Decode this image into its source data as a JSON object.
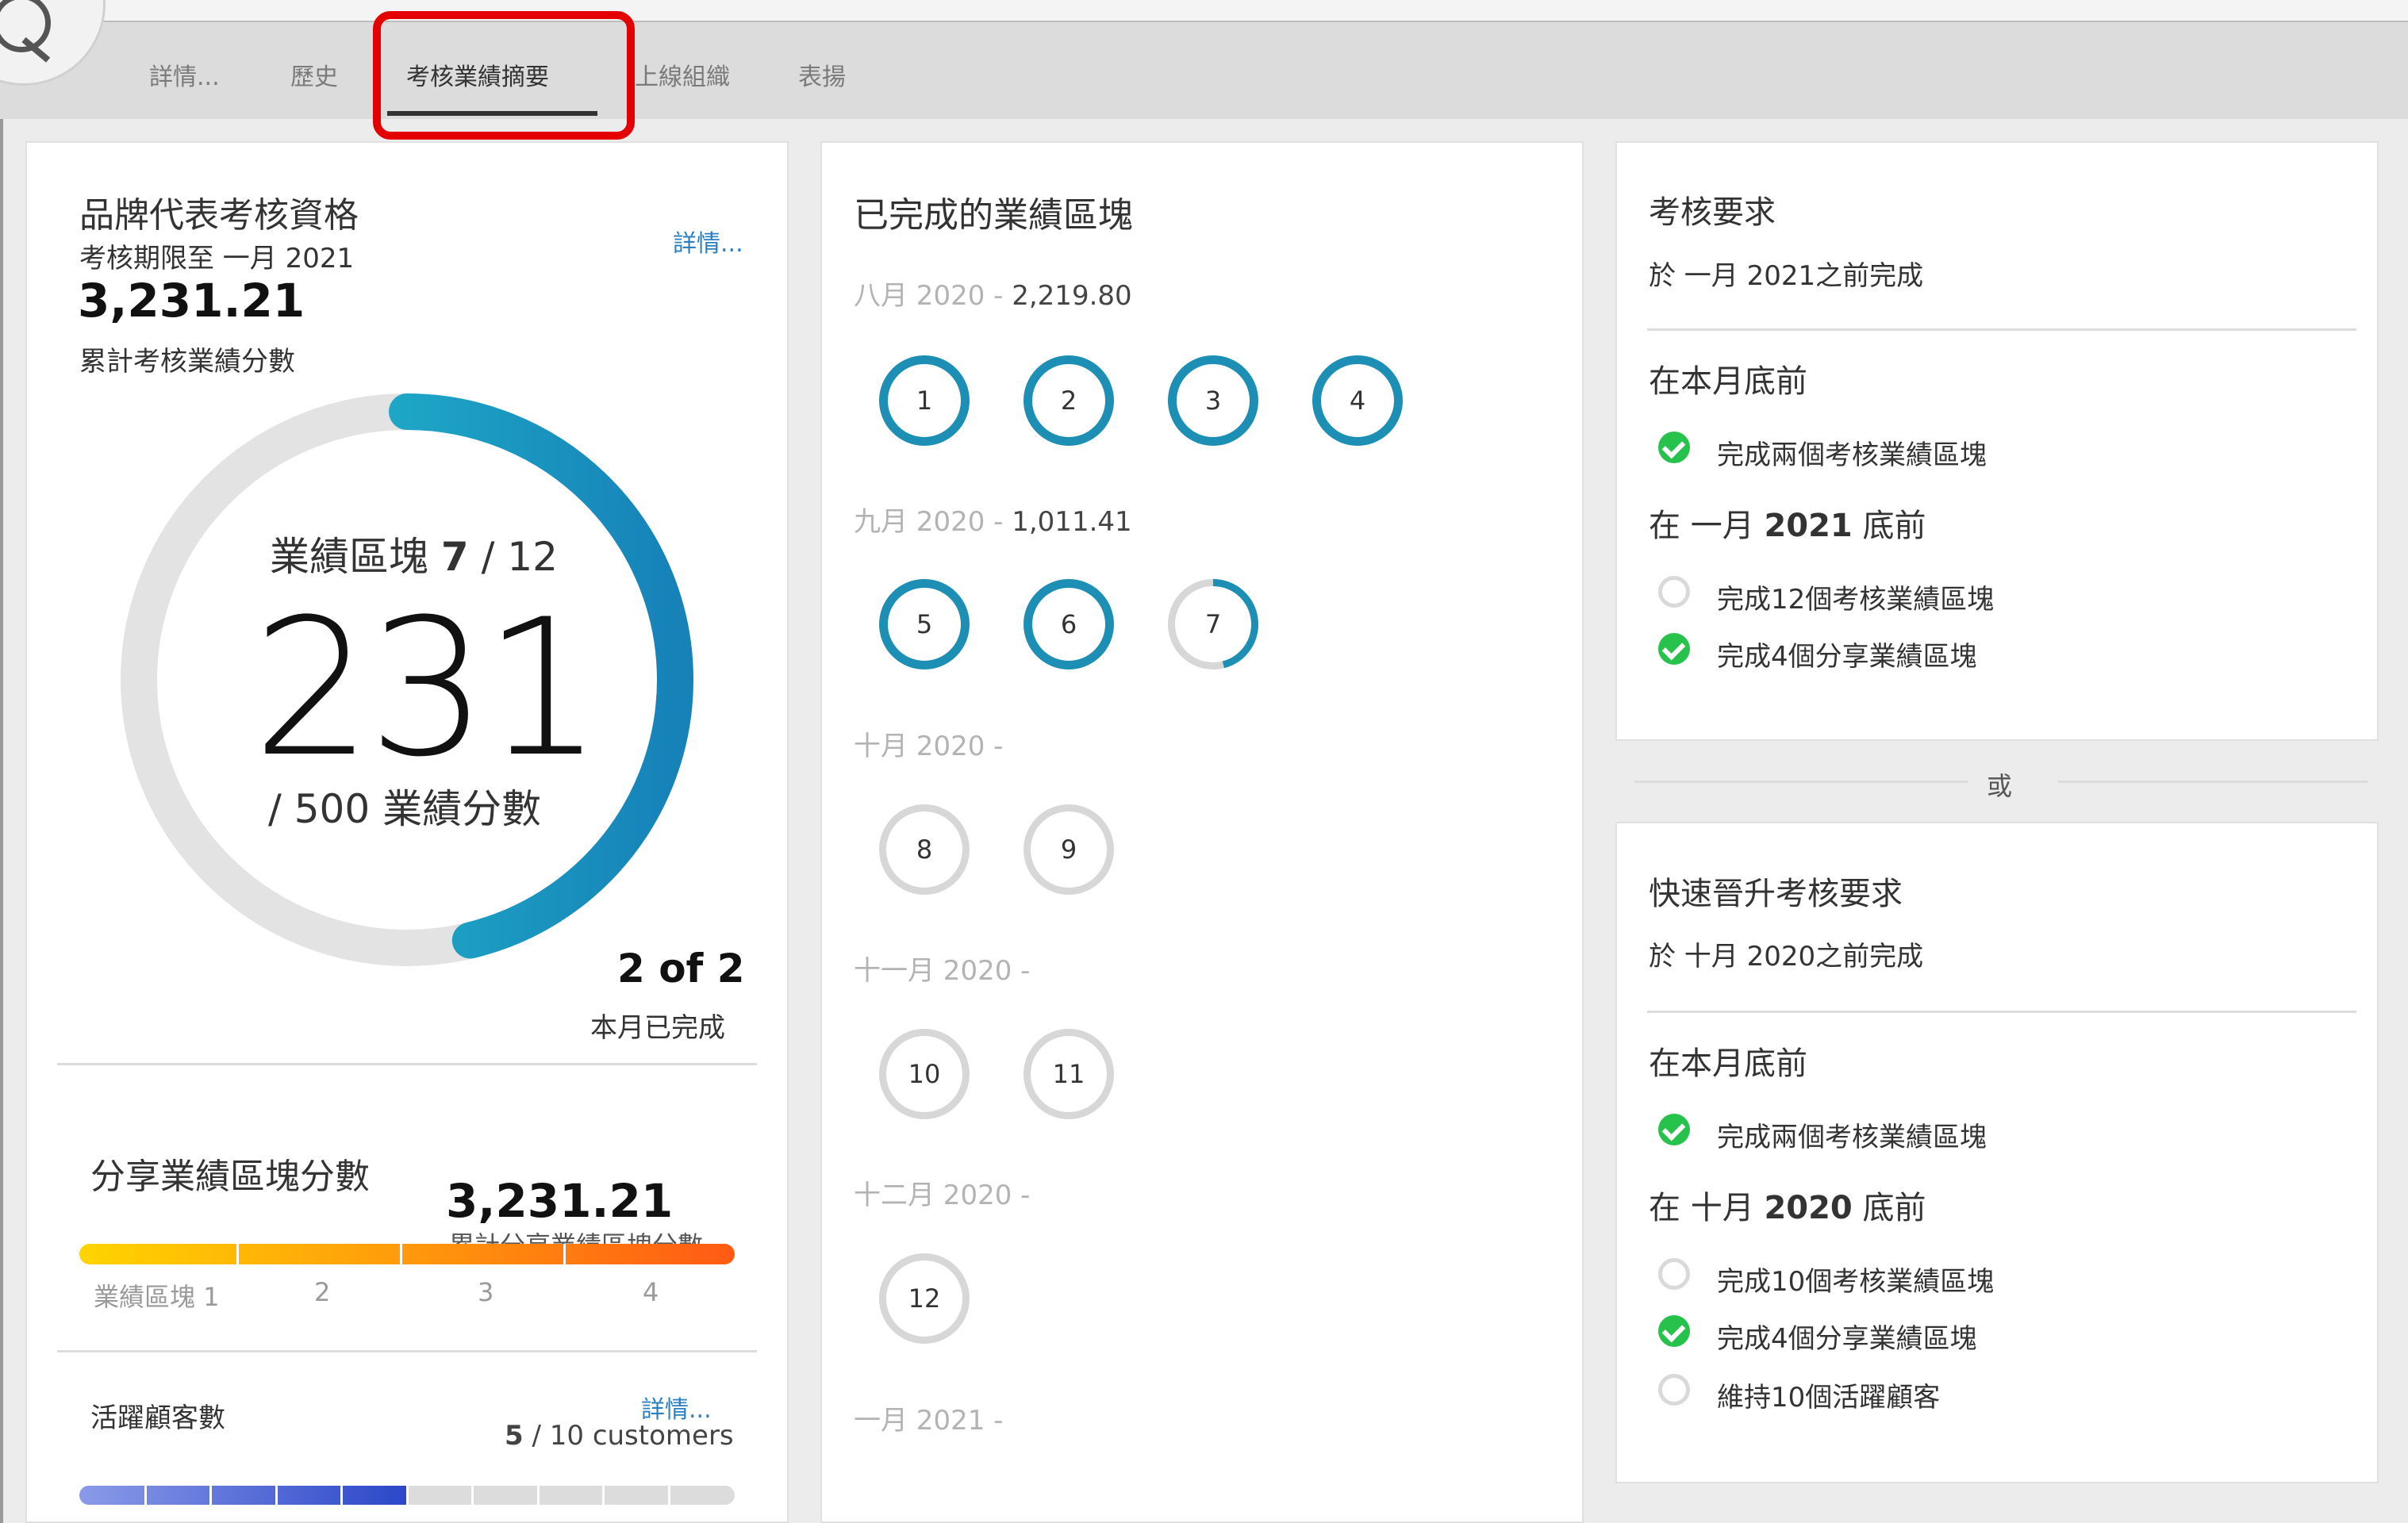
{
  "tabs": [
    {
      "label": "詳情..."
    },
    {
      "label": "歷史"
    },
    {
      "label": "考核業績摘要"
    },
    {
      "label": "上線組織"
    },
    {
      "label": "表揚"
    }
  ],
  "qualification": {
    "title": "品牌代表考核資格",
    "deadline": "考核期限至 一月 2021",
    "details_link": "詳情...",
    "total_points": "3,231.21",
    "total_points_label": "累計考核業績分數",
    "gauge": {
      "blocks_label": "業績區塊",
      "blocks_done": "7",
      "blocks_total": "/ 12",
      "points": "231",
      "points_target": "/ 500 業績分數",
      "progress_fraction": 0.462
    },
    "month_count": "2 of 2",
    "month_count_label": "本月已完成"
  },
  "shared_blocks": {
    "title": "分享業績區塊分數",
    "points": "3,231.21",
    "points_label": "累計分享業績區塊分數",
    "bar_labels": [
      "業績區塊 1",
      "2",
      "3",
      "4"
    ],
    "bar_fill_fraction": 1.0
  },
  "active_customers": {
    "title": "活躍顧客數",
    "details_link": "詳情...",
    "count": "5",
    "count_suffix": "/ 10 customers",
    "fill_fraction": 0.5
  },
  "completed_blocks": {
    "title": "已完成的業績區塊",
    "months": [
      {
        "label": "八月 2020 -",
        "points": "2,219.80",
        "blocks": [
          {
            "n": "1",
            "status": "done"
          },
          {
            "n": "2",
            "status": "done"
          },
          {
            "n": "3",
            "status": "done"
          },
          {
            "n": "4",
            "status": "done"
          }
        ]
      },
      {
        "label": "九月 2020 -",
        "points": "1,011.41",
        "blocks": [
          {
            "n": "5",
            "status": "done"
          },
          {
            "n": "6",
            "status": "done"
          },
          {
            "n": "7",
            "status": "partial",
            "fraction": 0.46
          }
        ]
      },
      {
        "label": "十月 2020 -",
        "points": "",
        "blocks": [
          {
            "n": "8",
            "status": "todo"
          },
          {
            "n": "9",
            "status": "todo"
          }
        ]
      },
      {
        "label": "十一月 2020 -",
        "points": "",
        "blocks": [
          {
            "n": "10",
            "status": "todo"
          },
          {
            "n": "11",
            "status": "todo"
          }
        ]
      },
      {
        "label": "十二月 2020 -",
        "points": "",
        "blocks": [
          {
            "n": "12",
            "status": "todo"
          }
        ]
      },
      {
        "label": "一月 2021 -",
        "points": "",
        "blocks": []
      }
    ]
  },
  "requirements": {
    "title": "考核要求",
    "subtitle": "於 一月 2021之前完成",
    "section1_title": "在本月底前",
    "section1_items": [
      {
        "text": "完成兩個考核業績區塊",
        "done": true
      }
    ],
    "section2_prefix": "在 一月 ",
    "section2_bold": "2021",
    "section2_suffix": " 底前",
    "section2_items": [
      {
        "text": "完成12個考核業績區塊",
        "done": false
      },
      {
        "text": "完成4個分享業績區塊",
        "done": true
      }
    ]
  },
  "or_label": "或",
  "fast_track": {
    "title": "快速晉升考核要求",
    "subtitle": "於 十月 2020之前完成",
    "section1_title": "在本月底前",
    "section1_items": [
      {
        "text": "完成兩個考核業績區塊",
        "done": true
      }
    ],
    "section2_prefix": "在 十月 ",
    "section2_bold": "2020",
    "section2_suffix": " 底前",
    "section2_items": [
      {
        "text": "完成10個考核業績區塊",
        "done": false
      },
      {
        "text": "完成4個分享業績區塊",
        "done": true
      },
      {
        "text": "維持10個活躍顧客",
        "done": false
      }
    ]
  },
  "colors": {
    "accent_teal": "#1d8fb5",
    "gauge_start": "#25c7d3",
    "gauge_end": "#1682b8",
    "check_green": "#27c24c",
    "link_blue": "#2a7fc2",
    "highlight_red": "#e40000"
  }
}
